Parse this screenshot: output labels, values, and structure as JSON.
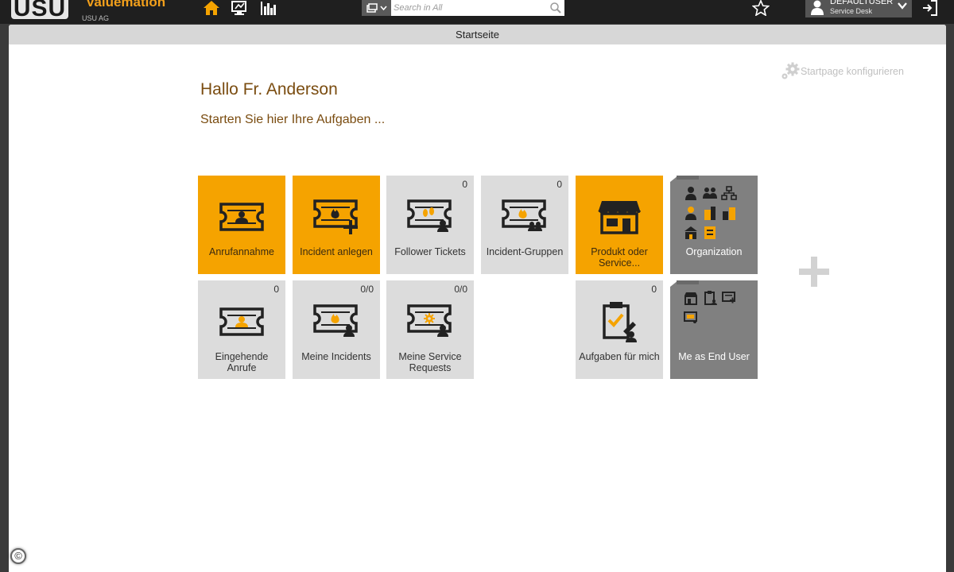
{
  "header": {
    "logo_text": "USU",
    "brand": "Valuemation",
    "company": "USU AG",
    "nav_icons": [
      "home-icon",
      "monitor-icon",
      "chart-icon"
    ],
    "search": {
      "placeholder": "Search in All"
    },
    "user": {
      "name": "DEFAULTUSER",
      "role": "Service Desk"
    }
  },
  "page": {
    "title": "Startseite",
    "configure_label": "Startpage konfigurieren",
    "greeting": "Hallo Fr. Anderson",
    "subtitle": "Starten Sie hier Ihre Aufgaben ..."
  },
  "tiles": [
    {
      "label": "Anrufannahme",
      "count": "",
      "style": "orange",
      "icon": "ticket-user-icon"
    },
    {
      "label": "Incident anlegen",
      "count": "",
      "style": "orange",
      "icon": "ticket-fire-add-icon"
    },
    {
      "label": "Follower Tickets",
      "count": "0",
      "style": "light",
      "icon": "ticket-steps-icon"
    },
    {
      "label": "Incident-Gruppen",
      "count": "0",
      "style": "light",
      "icon": "ticket-fire-group-icon"
    },
    {
      "label": "Produkt oder Service...",
      "count": "",
      "style": "orange",
      "icon": "shop-icon"
    },
    {
      "label": "Organization",
      "count": "",
      "style": "dark",
      "icon": "organization-folder-icon"
    },
    {
      "label": "Eingehende Anrufe",
      "count": "0",
      "style": "light",
      "icon": "ticket-incoming-icon"
    },
    {
      "label": "Meine Incidents",
      "count": "0/0",
      "style": "light",
      "icon": "ticket-fire-user-icon"
    },
    {
      "label": "Meine Service Requests",
      "count": "0/0",
      "style": "light",
      "icon": "ticket-gear-user-icon"
    },
    {
      "label": "Aufgaben für mich",
      "count": "0",
      "style": "light",
      "icon": "clipboard-task-icon"
    },
    {
      "label": "Me as End User",
      "count": "",
      "style": "dark",
      "icon": "end-user-folder-icon"
    }
  ],
  "colors": {
    "accent_orange": "#f5a300",
    "tile_light": "#dcdcdc",
    "tile_dark": "#808080",
    "heading_brown": "#7a4c10",
    "topbar": "#1f1f1f"
  },
  "footer": {
    "copyright_symbol": "©"
  }
}
